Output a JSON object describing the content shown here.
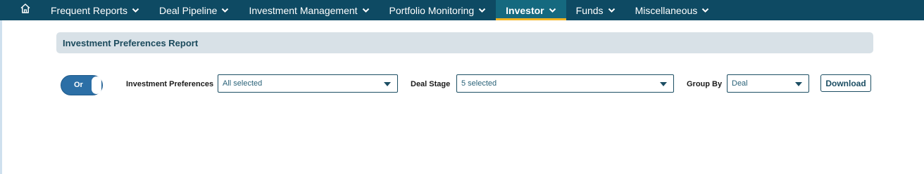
{
  "nav": {
    "items": [
      {
        "label": "Frequent Reports",
        "active": false
      },
      {
        "label": "Deal Pipeline",
        "active": false
      },
      {
        "label": "Investment Management",
        "active": false
      },
      {
        "label": "Portfolio Monitoring",
        "active": false
      },
      {
        "label": "Investor",
        "active": true
      },
      {
        "label": "Funds",
        "active": false
      },
      {
        "label": "Miscellaneous",
        "active": false
      }
    ],
    "home_icon": "home-icon",
    "dropdown_icon": "chevron-down-icon"
  },
  "report": {
    "title": "Investment Preferences Report"
  },
  "filters": {
    "toggle_label": "Or",
    "investment_preferences": {
      "label": "Investment Preferences",
      "value": "All selected"
    },
    "deal_stage": {
      "label": "Deal Stage",
      "value": "5 selected"
    },
    "group_by": {
      "label": "Group By",
      "value": "Deal"
    },
    "download_label": "Download"
  },
  "colors": {
    "navbar": "#0e4a63",
    "active_tab": "#15697f",
    "active_underline": "#f0b323",
    "header_panel": "#d8e1e7",
    "toggle": "#2c6fa6"
  }
}
